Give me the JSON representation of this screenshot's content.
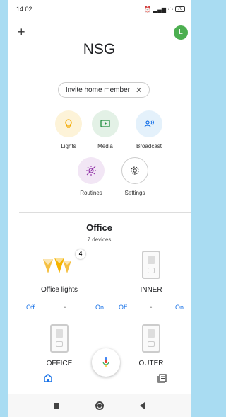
{
  "status": {
    "time": "14:02",
    "battery": "70"
  },
  "header": {
    "add_icon": "plus-icon",
    "avatar_letter": "L"
  },
  "home": {
    "title": "NSG"
  },
  "invite": {
    "label": "Invite home member",
    "close": "✕"
  },
  "quick_actions": [
    {
      "label": "Lights",
      "icon": "bulb-icon",
      "color": "#fdf3d8"
    },
    {
      "label": "Media",
      "icon": "media-icon",
      "color": "#e3f1e6"
    },
    {
      "label": "Broadcast",
      "icon": "broadcast-icon",
      "color": "#e4f1fb"
    },
    {
      "label": "Routines",
      "icon": "routines-icon",
      "color": "#f2e6f5"
    },
    {
      "label": "Settings",
      "icon": "gear-icon",
      "color": "#ffffff"
    }
  ],
  "room": {
    "title": "Office",
    "subtitle": "7 devices"
  },
  "devices": [
    {
      "name": "Office lights",
      "count": "4",
      "off": "Off",
      "on": "On"
    },
    {
      "name": "INNER",
      "off": "Off",
      "on": "On"
    },
    {
      "name": "OFFICE"
    },
    {
      "name": "OUTER"
    }
  ],
  "accent": "#1a73e8"
}
